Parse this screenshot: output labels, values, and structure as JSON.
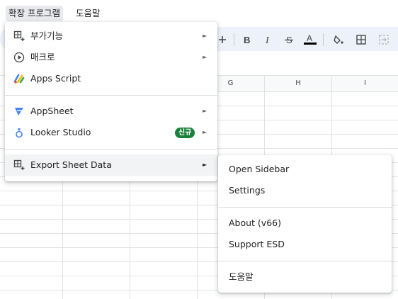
{
  "menubar": {
    "items": [
      {
        "label": "확장 프로그램",
        "active": true
      },
      {
        "label": "도움말",
        "active": false
      }
    ]
  },
  "toolbar": {
    "buttons": [
      "plus-icon",
      "bold-icon",
      "italic-icon",
      "strikethrough-icon",
      "text-color-icon",
      "fill-color-icon",
      "borders-icon",
      "merge-cells-icon"
    ],
    "text_color_bar": "#000000"
  },
  "grid": {
    "columns": [
      "G",
      "H",
      "I"
    ]
  },
  "extensions_menu": {
    "items": [
      {
        "label": "부가기능",
        "icon": "addon-icon",
        "submenu": true
      },
      {
        "label": "매크로",
        "icon": "macro-play-icon",
        "submenu": true
      },
      {
        "label": "Apps Script",
        "icon": "apps-script-icon",
        "submenu": false
      },
      {
        "label": "AppSheet",
        "icon": "appsheet-icon",
        "submenu": true
      },
      {
        "label": "Looker Studio",
        "icon": "looker-studio-icon",
        "submenu": true,
        "badge": "신규"
      },
      {
        "label": "Export Sheet Data",
        "icon": "addon-icon",
        "submenu": true
      }
    ],
    "submenu_arrow": "►"
  },
  "export_submenu": {
    "items": [
      {
        "label": "Open Sidebar"
      },
      {
        "label": "Settings"
      },
      {
        "label": "About (v66)"
      },
      {
        "label": "Support ESD"
      },
      {
        "label": "도움말"
      }
    ]
  },
  "colors": {
    "badge_green": "#188038",
    "toolbar_bg": "#edf2fa",
    "highlight": "#f1f3f4"
  }
}
